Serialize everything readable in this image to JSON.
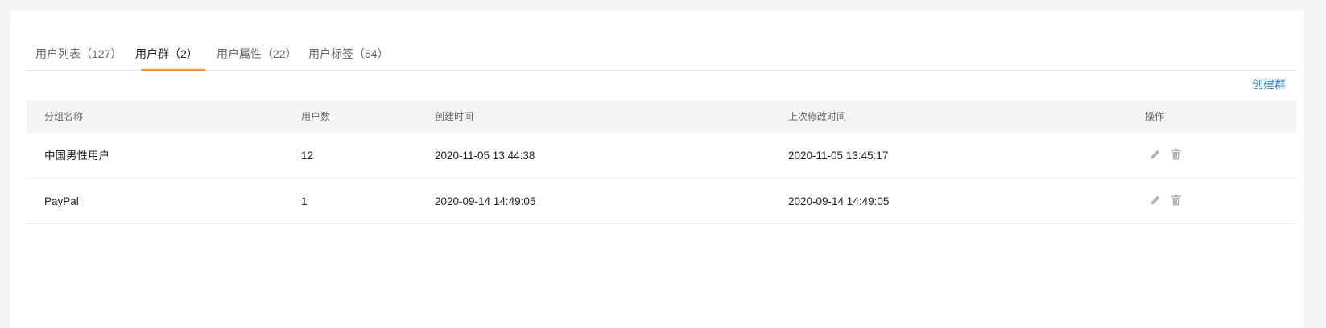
{
  "tabs": [
    {
      "label": "用户列表（127）",
      "active": false
    },
    {
      "label": "用户群（2）",
      "active": true
    },
    {
      "label": "用户属性（22）",
      "active": false
    },
    {
      "label": "用户标签（54）",
      "active": false
    }
  ],
  "actions": {
    "create_group_label": "创建群"
  },
  "table": {
    "columns": [
      "分组名称",
      "用户数",
      "创建时间",
      "上次修改时间",
      "操作"
    ],
    "rows": [
      {
        "name": "中国男性用户",
        "count": "12",
        "created": "2020-11-05 13:44:38",
        "modified": "2020-11-05 13:45:17",
        "ops": [
          "edit-icon",
          "delete-icon"
        ]
      },
      {
        "name": "PayPal",
        "count": "1",
        "created": "2020-09-14 14:49:05",
        "modified": "2020-09-14 14:49:05",
        "ops": [
          "edit-icon",
          "delete-icon"
        ]
      }
    ]
  },
  "colors": {
    "accent": "#f7941d",
    "link": "#2f88e3",
    "header_bg": "#f5f5f5",
    "icon": "#b3b3b3"
  }
}
